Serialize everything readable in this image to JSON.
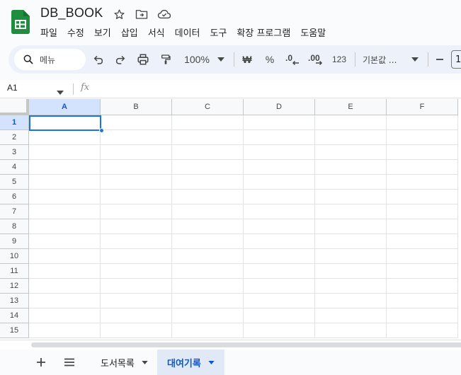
{
  "app": {
    "doc_title": "DB_BOOK",
    "accent": "#1a73e8",
    "brand_green": "#1e8e3e"
  },
  "menu": [
    "파일",
    "수정",
    "보기",
    "삽입",
    "서식",
    "데이터",
    "도구",
    "확장 프로그램",
    "도움말"
  ],
  "toolbar": {
    "search_label": "메뉴",
    "zoom": "100%",
    "currency": "₩",
    "percent": "%",
    "number_format": "123",
    "font_name": "기본값 ...",
    "font_size": "1"
  },
  "formula_bar": {
    "cell_ref": "A1",
    "value": ""
  },
  "grid": {
    "columns": [
      "A",
      "B",
      "C",
      "D",
      "E",
      "F"
    ],
    "rows": [
      "1",
      "2",
      "3",
      "4",
      "5",
      "6",
      "7",
      "8",
      "9",
      "10",
      "11",
      "12",
      "13",
      "14",
      "15"
    ],
    "selected": "A1"
  },
  "sheets": [
    {
      "name": "도서목록",
      "active": false
    },
    {
      "name": "대여기록",
      "active": true
    }
  ]
}
